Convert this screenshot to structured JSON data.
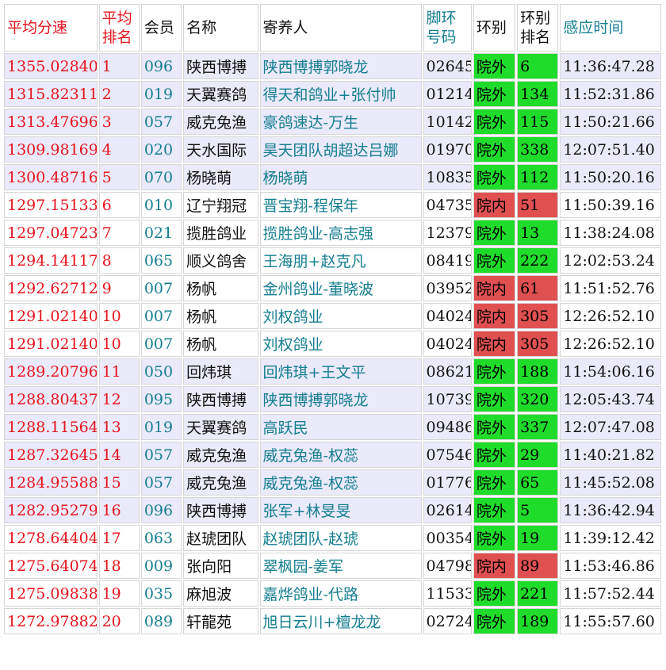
{
  "colors": {
    "outside_bg": "#1fdc2a",
    "inside_bg": "#e05050",
    "shaded_row_bg": "#eaeafa",
    "red_text": "#e8141e",
    "teal_text": "#157e91"
  },
  "headers": {
    "avg_speed": "平均分速",
    "avg_rank_1": "平均",
    "avg_rank_2": "排名",
    "member": "会员",
    "name": "名称",
    "owner": "寄养人",
    "ring_1": "脚环",
    "ring_2": "号码",
    "location": "环别",
    "loc_rank_1": "环别",
    "loc_rank_2": "排名",
    "time": "感应时间"
  },
  "rows": [
    {
      "speed": "1355.02840",
      "rank": "1",
      "member": "096",
      "name": "陕西博搏",
      "owner": "陕西博搏郭晓龙",
      "ring": "02645",
      "location": "院外",
      "loc_type": "out",
      "loc_rank": "6",
      "time": "11:36:47.28"
    },
    {
      "speed": "1315.82311",
      "rank": "2",
      "member": "019",
      "name": "天翼赛鸽",
      "owner": "得天和鸽业+张付帅",
      "ring": "01214",
      "location": "院外",
      "loc_type": "out",
      "loc_rank": "134",
      "time": "11:52:31.86"
    },
    {
      "speed": "1313.47696",
      "rank": "3",
      "member": "057",
      "name": "威克兔渔",
      "owner": "豪鸽速达-万生",
      "ring": "10142",
      "location": "院外",
      "loc_type": "out",
      "loc_rank": "115",
      "time": "11:50:21.66"
    },
    {
      "speed": "1309.98169",
      "rank": "4",
      "member": "020",
      "name": "天水国际",
      "owner": "昊天团队胡超达吕娜",
      "ring": "01970",
      "location": "院外",
      "loc_type": "out",
      "loc_rank": "338",
      "time": "12:07:51.40"
    },
    {
      "speed": "1300.48716",
      "rank": "5",
      "member": "070",
      "name": "杨晓萌",
      "owner": "杨晓萌",
      "ring": "10835",
      "location": "院外",
      "loc_type": "out",
      "loc_rank": "112",
      "time": "11:50:20.16"
    },
    {
      "speed": "1297.15133",
      "rank": "6",
      "member": "010",
      "name": "辽宁翔冠",
      "owner": "晋宝翔-程保年",
      "ring": "04735",
      "location": "院内",
      "loc_type": "in",
      "loc_rank": "51",
      "time": "11:50:39.16"
    },
    {
      "speed": "1297.04723",
      "rank": "7",
      "member": "021",
      "name": "揽胜鸽业",
      "owner": "揽胜鸽业-高志强",
      "ring": "12379",
      "location": "院外",
      "loc_type": "out",
      "loc_rank": "13",
      "time": "11:38:24.08"
    },
    {
      "speed": "1294.14117",
      "rank": "8",
      "member": "065",
      "name": "顺义鸽舍",
      "owner": "王海朋+赵克凡",
      "ring": "08419",
      "location": "院外",
      "loc_type": "out",
      "loc_rank": "222",
      "time": "12:02:53.24"
    },
    {
      "speed": "1292.62712",
      "rank": "9",
      "member": "007",
      "name": "杨帆",
      "owner": "金州鸽业-董晓波",
      "ring": "03952",
      "location": "院内",
      "loc_type": "in",
      "loc_rank": "61",
      "time": "11:51:52.76"
    },
    {
      "speed": "1291.02140",
      "rank": "10",
      "member": "007",
      "name": "杨帆",
      "owner": "刘权鸽业",
      "ring": "04024",
      "location": "院内",
      "loc_type": "in",
      "loc_rank": "305",
      "time": "12:26:52.10"
    },
    {
      "speed": "1291.02140",
      "rank": "10",
      "member": "007",
      "name": "杨帆",
      "owner": "刘权鸽业",
      "ring": "04024",
      "location": "院内",
      "loc_type": "in",
      "loc_rank": "305",
      "time": "12:26:52.10"
    },
    {
      "speed": "1289.20796",
      "rank": "11",
      "member": "050",
      "name": "回炜琪",
      "owner": "回炜琪+王文平",
      "ring": "08621",
      "location": "院外",
      "loc_type": "out",
      "loc_rank": "188",
      "time": "11:54:06.16"
    },
    {
      "speed": "1288.80437",
      "rank": "12",
      "member": "095",
      "name": "陕西博搏",
      "owner": "陕西博搏郭晓龙",
      "ring": "10739",
      "location": "院外",
      "loc_type": "out",
      "loc_rank": "320",
      "time": "12:05:43.74"
    },
    {
      "speed": "1288.11564",
      "rank": "13",
      "member": "019",
      "name": "天翼赛鸽",
      "owner": "高跃民",
      "ring": "09486",
      "location": "院外",
      "loc_type": "out",
      "loc_rank": "337",
      "time": "12:07:47.08"
    },
    {
      "speed": "1287.32645",
      "rank": "14",
      "member": "057",
      "name": "威克兔渔",
      "owner": "威克兔渔-权蕊",
      "ring": "07546",
      "location": "院外",
      "loc_type": "out",
      "loc_rank": "29",
      "time": "11:40:21.82"
    },
    {
      "speed": "1284.95588",
      "rank": "15",
      "member": "057",
      "name": "威克兔渔",
      "owner": "威克兔渔-权蕊",
      "ring": "01776",
      "location": "院外",
      "loc_type": "out",
      "loc_rank": "65",
      "time": "11:45:52.08"
    },
    {
      "speed": "1282.95279",
      "rank": "16",
      "member": "096",
      "name": "陕西博搏",
      "owner": "张军+林旻旻",
      "ring": "02614",
      "location": "院外",
      "loc_type": "out",
      "loc_rank": "5",
      "time": "11:36:42.94"
    },
    {
      "speed": "1278.64404",
      "rank": "17",
      "member": "063",
      "name": "赵琥团队",
      "owner": "赵琥团队-赵琥",
      "ring": "00354",
      "location": "院外",
      "loc_type": "out",
      "loc_rank": "19",
      "time": "11:39:12.42"
    },
    {
      "speed": "1275.64074",
      "rank": "18",
      "member": "009",
      "name": "张向阳",
      "owner": "翠枫园-姜军",
      "ring": "04798",
      "location": "院内",
      "loc_type": "in",
      "loc_rank": "89",
      "time": "11:53:46.86"
    },
    {
      "speed": "1275.09838",
      "rank": "19",
      "member": "035",
      "name": "麻旭波",
      "owner": "嘉烨鸽业-代路",
      "ring": "11533",
      "location": "院外",
      "loc_type": "out",
      "loc_rank": "221",
      "time": "11:57:52.44"
    },
    {
      "speed": "1272.97882",
      "rank": "20",
      "member": "089",
      "name": "轩龍苑",
      "owner": "旭日云川+檀龙龙",
      "ring": "02724",
      "location": "院外",
      "loc_type": "out",
      "loc_rank": "189",
      "time": "11:55:57.60"
    }
  ]
}
